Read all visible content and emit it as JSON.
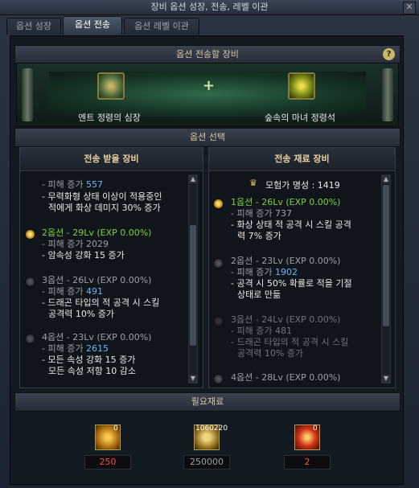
{
  "window": {
    "title": "장비 옵션 성장, 전송, 레벨 이관",
    "close_icon": "close-icon"
  },
  "tabs": [
    {
      "label": "옵션 성장",
      "active": false
    },
    {
      "label": "옵션 전송",
      "active": true
    },
    {
      "label": "옵션 레벨 이관",
      "active": false
    }
  ],
  "transfer_equipment": {
    "title": "옵션 전송할 장비",
    "source_item": {
      "name": "엔트 정령의 심장",
      "icon": "ent-spirit-heart-icon"
    },
    "target_item": {
      "name": "숲속의 마녀 정령석",
      "icon": "forest-witch-spirit-stone-icon"
    },
    "plus": "+"
  },
  "option_select": {
    "title": "옵션 선택"
  },
  "receive_panel": {
    "title": "전송 받을 장비",
    "top_lines": [
      {
        "prefix": "- 피해 증가 ",
        "value": "557"
      },
      {
        "text": "- 무력화형 상태 이상이 적용중인"
      },
      {
        "text": "적에게 화상 데미지 30% 증가"
      }
    ],
    "options": [
      {
        "header": "2옵션 - 29Lv (EXP 0.00%)",
        "selected": true,
        "lines": [
          {
            "prefix": "- 피해 증가 ",
            "value": "2029"
          },
          {
            "text": "- 암속성 강화 15 증가"
          }
        ]
      },
      {
        "header": "3옵션 - 26Lv (EXP 0.00%)",
        "selected": false,
        "lines": [
          {
            "prefix": "- 피해 증가 ",
            "value": "491"
          },
          {
            "text": "- 드래곤 타입의 적 공격 시 스킬"
          },
          {
            "text": "공격력 10% 증가"
          }
        ]
      },
      {
        "header": "4옵션 - 23Lv (EXP 0.00%)",
        "selected": false,
        "lines": [
          {
            "prefix": "- 피해 증가 ",
            "value": "2615"
          },
          {
            "text": "- 모든 속성 강화 15 증가"
          },
          {
            "text": "모든 속성 저항 10 감소"
          }
        ]
      }
    ]
  },
  "material_panel": {
    "title": "전송 재료 장비",
    "fame": "모험가 명성 : 1419",
    "options": [
      {
        "header": "1옵션 - 26Lv (EXP 0.00%)",
        "state": "selected",
        "lines": [
          {
            "prefix": "- 피해 증가 ",
            "value": "737"
          },
          {
            "text": "- 화상 상태 적 공격 시 스킬 공격"
          },
          {
            "text": "력 7% 증가"
          }
        ]
      },
      {
        "header": "2옵션 - 23Lv (EXP 0.00%)",
        "state": "normal",
        "lines": [
          {
            "prefix": "- 피해 증가 ",
            "value": "1902"
          },
          {
            "text": "- 공격 시 50% 확률로 적을 기절"
          },
          {
            "text": "상태로 만듦"
          }
        ]
      },
      {
        "header": "3옵션 - 24Lv (EXP 0.00%)",
        "state": "disabled",
        "lines": [
          {
            "prefix": "- 피해 증가 ",
            "value": "481"
          },
          {
            "text": "- 드래곤 타입의 적 공격 시 스킬"
          },
          {
            "text": "공격력 10% 증가"
          }
        ]
      },
      {
        "header": "4옵션 - 28Lv (EXP 0.00%)",
        "state": "normal",
        "lines": []
      }
    ]
  },
  "required": {
    "title": "필요재료",
    "materials": [
      {
        "icon": "golden-box-icon",
        "badge": "0",
        "count": "250"
      },
      {
        "icon": "gold-coins-icon",
        "badge": "1060220",
        "count": "250000"
      },
      {
        "icon": "red-crystal-icon",
        "badge": "0",
        "count": "2"
      }
    ]
  },
  "colors": {
    "option_green": "#7ed03c",
    "value_blue": "#6fb6ee",
    "title_gold": "#e7d2a2",
    "count_red": "#ff4a4a"
  }
}
